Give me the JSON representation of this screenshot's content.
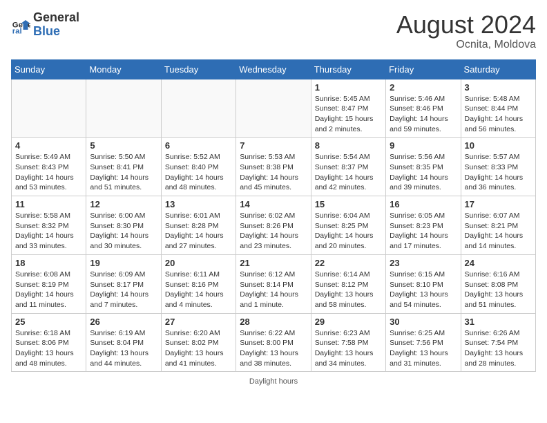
{
  "header": {
    "logo_general": "General",
    "logo_blue": "Blue",
    "month_year": "August 2024",
    "location": "Ocnita, Moldova"
  },
  "weekdays": [
    "Sunday",
    "Monday",
    "Tuesday",
    "Wednesday",
    "Thursday",
    "Friday",
    "Saturday"
  ],
  "footer": "Daylight hours",
  "weeks": [
    [
      {
        "day": "",
        "info": ""
      },
      {
        "day": "",
        "info": ""
      },
      {
        "day": "",
        "info": ""
      },
      {
        "day": "",
        "info": ""
      },
      {
        "day": "1",
        "info": "Sunrise: 5:45 AM\nSunset: 8:47 PM\nDaylight: 15 hours\nand 2 minutes."
      },
      {
        "day": "2",
        "info": "Sunrise: 5:46 AM\nSunset: 8:46 PM\nDaylight: 14 hours\nand 59 minutes."
      },
      {
        "day": "3",
        "info": "Sunrise: 5:48 AM\nSunset: 8:44 PM\nDaylight: 14 hours\nand 56 minutes."
      }
    ],
    [
      {
        "day": "4",
        "info": "Sunrise: 5:49 AM\nSunset: 8:43 PM\nDaylight: 14 hours\nand 53 minutes."
      },
      {
        "day": "5",
        "info": "Sunrise: 5:50 AM\nSunset: 8:41 PM\nDaylight: 14 hours\nand 51 minutes."
      },
      {
        "day": "6",
        "info": "Sunrise: 5:52 AM\nSunset: 8:40 PM\nDaylight: 14 hours\nand 48 minutes."
      },
      {
        "day": "7",
        "info": "Sunrise: 5:53 AM\nSunset: 8:38 PM\nDaylight: 14 hours\nand 45 minutes."
      },
      {
        "day": "8",
        "info": "Sunrise: 5:54 AM\nSunset: 8:37 PM\nDaylight: 14 hours\nand 42 minutes."
      },
      {
        "day": "9",
        "info": "Sunrise: 5:56 AM\nSunset: 8:35 PM\nDaylight: 14 hours\nand 39 minutes."
      },
      {
        "day": "10",
        "info": "Sunrise: 5:57 AM\nSunset: 8:33 PM\nDaylight: 14 hours\nand 36 minutes."
      }
    ],
    [
      {
        "day": "11",
        "info": "Sunrise: 5:58 AM\nSunset: 8:32 PM\nDaylight: 14 hours\nand 33 minutes."
      },
      {
        "day": "12",
        "info": "Sunrise: 6:00 AM\nSunset: 8:30 PM\nDaylight: 14 hours\nand 30 minutes."
      },
      {
        "day": "13",
        "info": "Sunrise: 6:01 AM\nSunset: 8:28 PM\nDaylight: 14 hours\nand 27 minutes."
      },
      {
        "day": "14",
        "info": "Sunrise: 6:02 AM\nSunset: 8:26 PM\nDaylight: 14 hours\nand 23 minutes."
      },
      {
        "day": "15",
        "info": "Sunrise: 6:04 AM\nSunset: 8:25 PM\nDaylight: 14 hours\nand 20 minutes."
      },
      {
        "day": "16",
        "info": "Sunrise: 6:05 AM\nSunset: 8:23 PM\nDaylight: 14 hours\nand 17 minutes."
      },
      {
        "day": "17",
        "info": "Sunrise: 6:07 AM\nSunset: 8:21 PM\nDaylight: 14 hours\nand 14 minutes."
      }
    ],
    [
      {
        "day": "18",
        "info": "Sunrise: 6:08 AM\nSunset: 8:19 PM\nDaylight: 14 hours\nand 11 minutes."
      },
      {
        "day": "19",
        "info": "Sunrise: 6:09 AM\nSunset: 8:17 PM\nDaylight: 14 hours\nand 7 minutes."
      },
      {
        "day": "20",
        "info": "Sunrise: 6:11 AM\nSunset: 8:16 PM\nDaylight: 14 hours\nand 4 minutes."
      },
      {
        "day": "21",
        "info": "Sunrise: 6:12 AM\nSunset: 8:14 PM\nDaylight: 14 hours\nand 1 minute."
      },
      {
        "day": "22",
        "info": "Sunrise: 6:14 AM\nSunset: 8:12 PM\nDaylight: 13 hours\nand 58 minutes."
      },
      {
        "day": "23",
        "info": "Sunrise: 6:15 AM\nSunset: 8:10 PM\nDaylight: 13 hours\nand 54 minutes."
      },
      {
        "day": "24",
        "info": "Sunrise: 6:16 AM\nSunset: 8:08 PM\nDaylight: 13 hours\nand 51 minutes."
      }
    ],
    [
      {
        "day": "25",
        "info": "Sunrise: 6:18 AM\nSunset: 8:06 PM\nDaylight: 13 hours\nand 48 minutes."
      },
      {
        "day": "26",
        "info": "Sunrise: 6:19 AM\nSunset: 8:04 PM\nDaylight: 13 hours\nand 44 minutes."
      },
      {
        "day": "27",
        "info": "Sunrise: 6:20 AM\nSunset: 8:02 PM\nDaylight: 13 hours\nand 41 minutes."
      },
      {
        "day": "28",
        "info": "Sunrise: 6:22 AM\nSunset: 8:00 PM\nDaylight: 13 hours\nand 38 minutes."
      },
      {
        "day": "29",
        "info": "Sunrise: 6:23 AM\nSunset: 7:58 PM\nDaylight: 13 hours\nand 34 minutes."
      },
      {
        "day": "30",
        "info": "Sunrise: 6:25 AM\nSunset: 7:56 PM\nDaylight: 13 hours\nand 31 minutes."
      },
      {
        "day": "31",
        "info": "Sunrise: 6:26 AM\nSunset: 7:54 PM\nDaylight: 13 hours\nand 28 minutes."
      }
    ]
  ]
}
